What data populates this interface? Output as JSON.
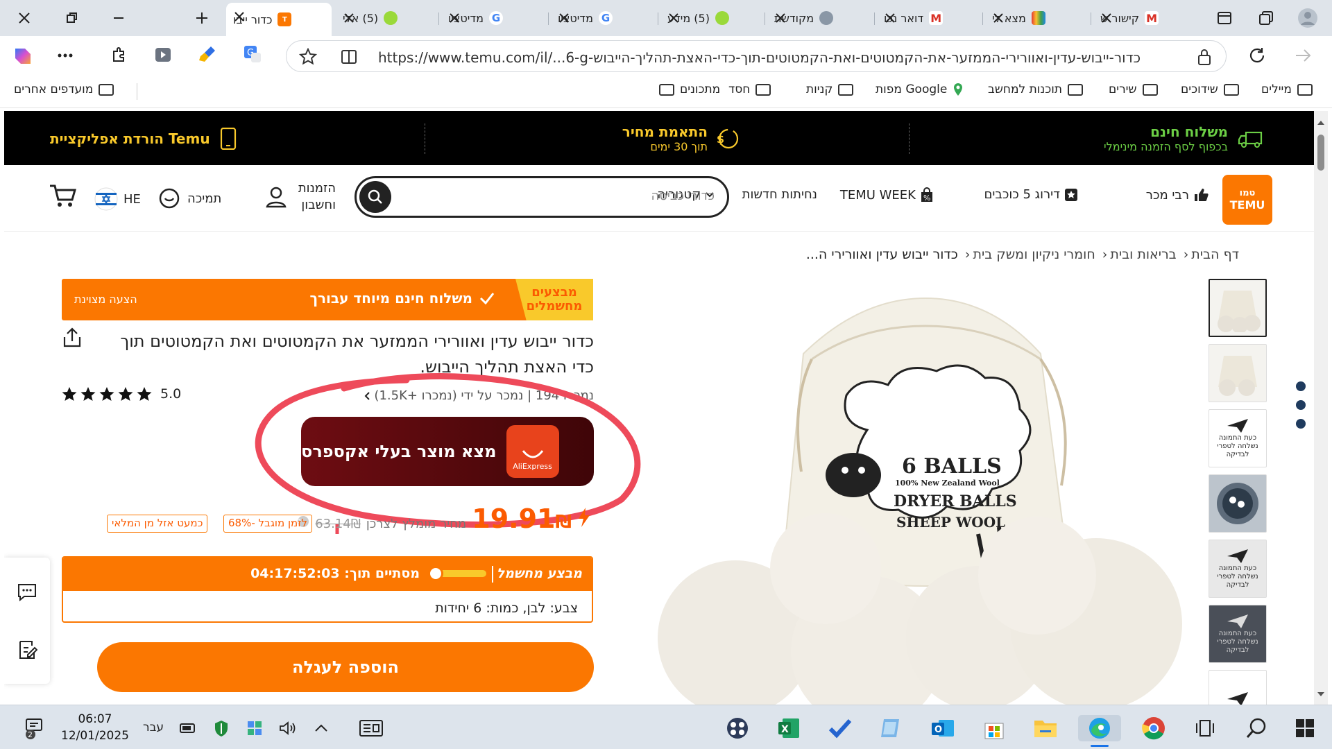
{
  "browser": {
    "tabs": [
      {
        "label": "כדור ייבו",
        "favicon": "temu",
        "active": true
      },
      {
        "label": "(5) אלי",
        "favicon": "whatsapp"
      },
      {
        "label": "מדיטציו",
        "favicon": "google"
      },
      {
        "label": "מדיטציו",
        "favicon": "google"
      },
      {
        "label": "(5) מידע",
        "favicon": "whatsapp"
      },
      {
        "label": "מקודשת",
        "favicon": "tab-generic"
      },
      {
        "label": "דואר נכו",
        "favicon": "gmail"
      },
      {
        "label": "מצא לי",
        "favicon": "rainbow"
      },
      {
        "label": "קישור ש",
        "favicon": "gmail"
      }
    ],
    "url": "https://www.temu.com/il/...6-g-כדור-ייבוש-עדין-ואוורירי-הממזער-את-הקמטוטים-ואת-הקמטוטים-תוך-כדי-האצת-תהליך-הייבוש",
    "bookmarks": [
      "מיילים",
      "שידוכים",
      "שירים",
      "תוכנות למחשב",
      "מפות Google",
      "קניות",
      "חסד",
      "מתכונים"
    ],
    "other_bookmarks": "מועדפים אחרים"
  },
  "promo": {
    "free_shipping_title": "משלוח חינם",
    "free_shipping_sub": "בכפוף לסף הזמנה מינימלי",
    "price_match_title": "התאמת מחיר",
    "price_match_sub": "תוך 30 ימים",
    "app_download": "הורדת אפליקציית Temu"
  },
  "header": {
    "logo_top": "טמו",
    "logo_bottom": "TEMU",
    "nav": [
      "רבי מכר",
      "דירוג 5 כוכבים",
      "TEMU WEEK",
      "נחיתות חדשות",
      "קטגוריה"
    ],
    "search_placeholder": "כדורי כביסה",
    "account": "הזמנות וחשבון",
    "support": "תמיכה",
    "language": "HE"
  },
  "breadcrumb": [
    "דף הבית",
    "בריאות ובית",
    "חומרי ניקיון ומשק בית",
    "כדור ייבוש עדין ואוורירי ה..."
  ],
  "product": {
    "banner_yellow": "מבצעים מחשמלים",
    "banner_text": "משלוח חינם מיוחד עבורך",
    "banner_right": "הצעה מצוינת",
    "title": "כדור ייבוש עדין ואוורירי הממזער את הקמטוטים ואת הקמטוטים תוך כדי האצת תהליך הייבוש.",
    "rating": "5.0",
    "sold_line": "נמכרו 194 | נמכר על ידי  (נמכרו +1.5K)",
    "aliexpress_button": "מצא מוצר בעלי אקספרס",
    "aliexpress_icon_label": "AliExpress",
    "price": "19.91",
    "currency": "₪",
    "reference_label": "מחיר מומלץ לצרכן",
    "reference_price": "63.14₪",
    "discount_badge": "68%- לזמן מוגבל",
    "stock_badge": "כמעט אזל מן המלאי",
    "deal_label": "מבצע מחשמל",
    "deal_ends": "מסתיים תוך: 04:17:52:03",
    "variant": "צבע: לבן, כמות: 6 יחידות",
    "add_to_cart": "הוספה לעגלה"
  },
  "image": {
    "bag_line1": "6 BALLS",
    "bag_line2": "100% New Zealand Wool",
    "bag_line3": "DRYER BALLS",
    "bag_line4": "SHEEP WOOL"
  },
  "thumbnail_notice": "כעת התמונה נשלחה לטפרי לבדיקה",
  "taskbar": {
    "time": "06:07",
    "date": "12/01/2025",
    "lang": "עבר",
    "notifications": "2"
  },
  "colors": {
    "temu_orange": "#fb7701",
    "promo_green": "#6ccf45",
    "promo_yellow": "#f9c92b"
  }
}
